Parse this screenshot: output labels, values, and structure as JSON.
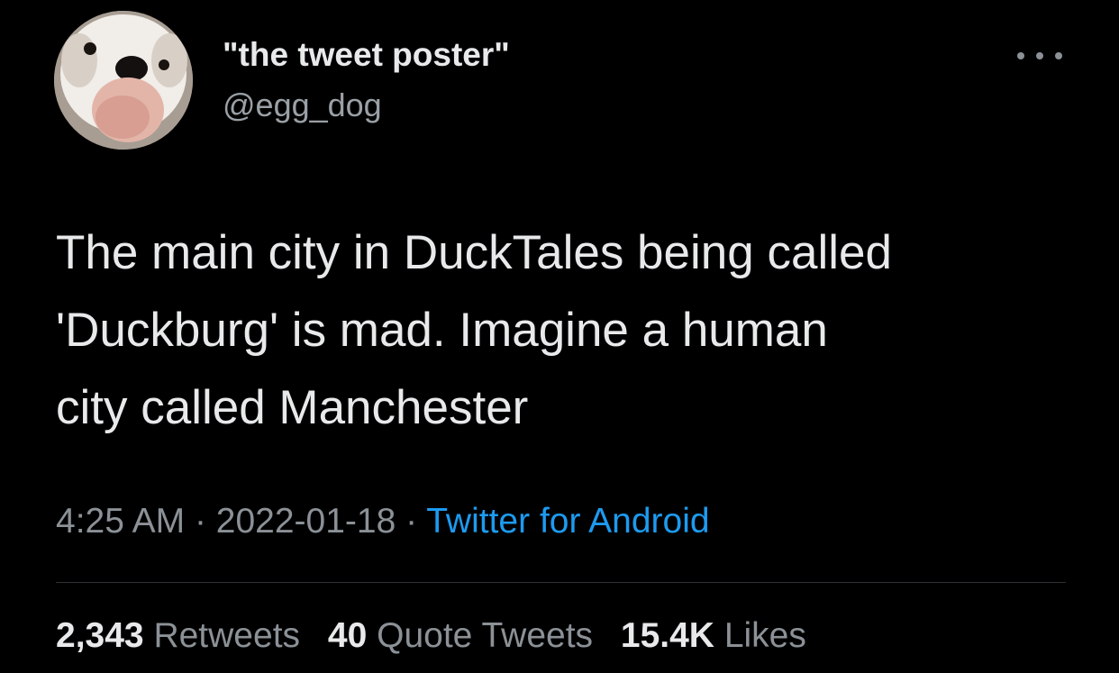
{
  "author": {
    "display_name": "\"the tweet poster\"",
    "handle": "@egg_dog"
  },
  "avatar_icon": "bulldog-avatar",
  "more_icon": "more-options-icon",
  "tweet": {
    "lines": [
      "The main city in DuckTales being called",
      "'Duckburg' is mad. Imagine a human",
      "city called Manchester"
    ]
  },
  "meta": {
    "time": "4:25 AM",
    "separator": "·",
    "date": "2022-01-18",
    "source": "Twitter for Android"
  },
  "stats": {
    "retweets_count": "2,343",
    "retweets_label": "Retweets",
    "quotes_count": "40",
    "quotes_label": "Quote Tweets",
    "likes_count": "15.4K",
    "likes_label": "Likes"
  },
  "colors": {
    "background": "#000000",
    "text": "#e7e9ea",
    "secondary_text": "#8b9196",
    "link": "#1d9bf0",
    "divider": "#2f3336"
  }
}
